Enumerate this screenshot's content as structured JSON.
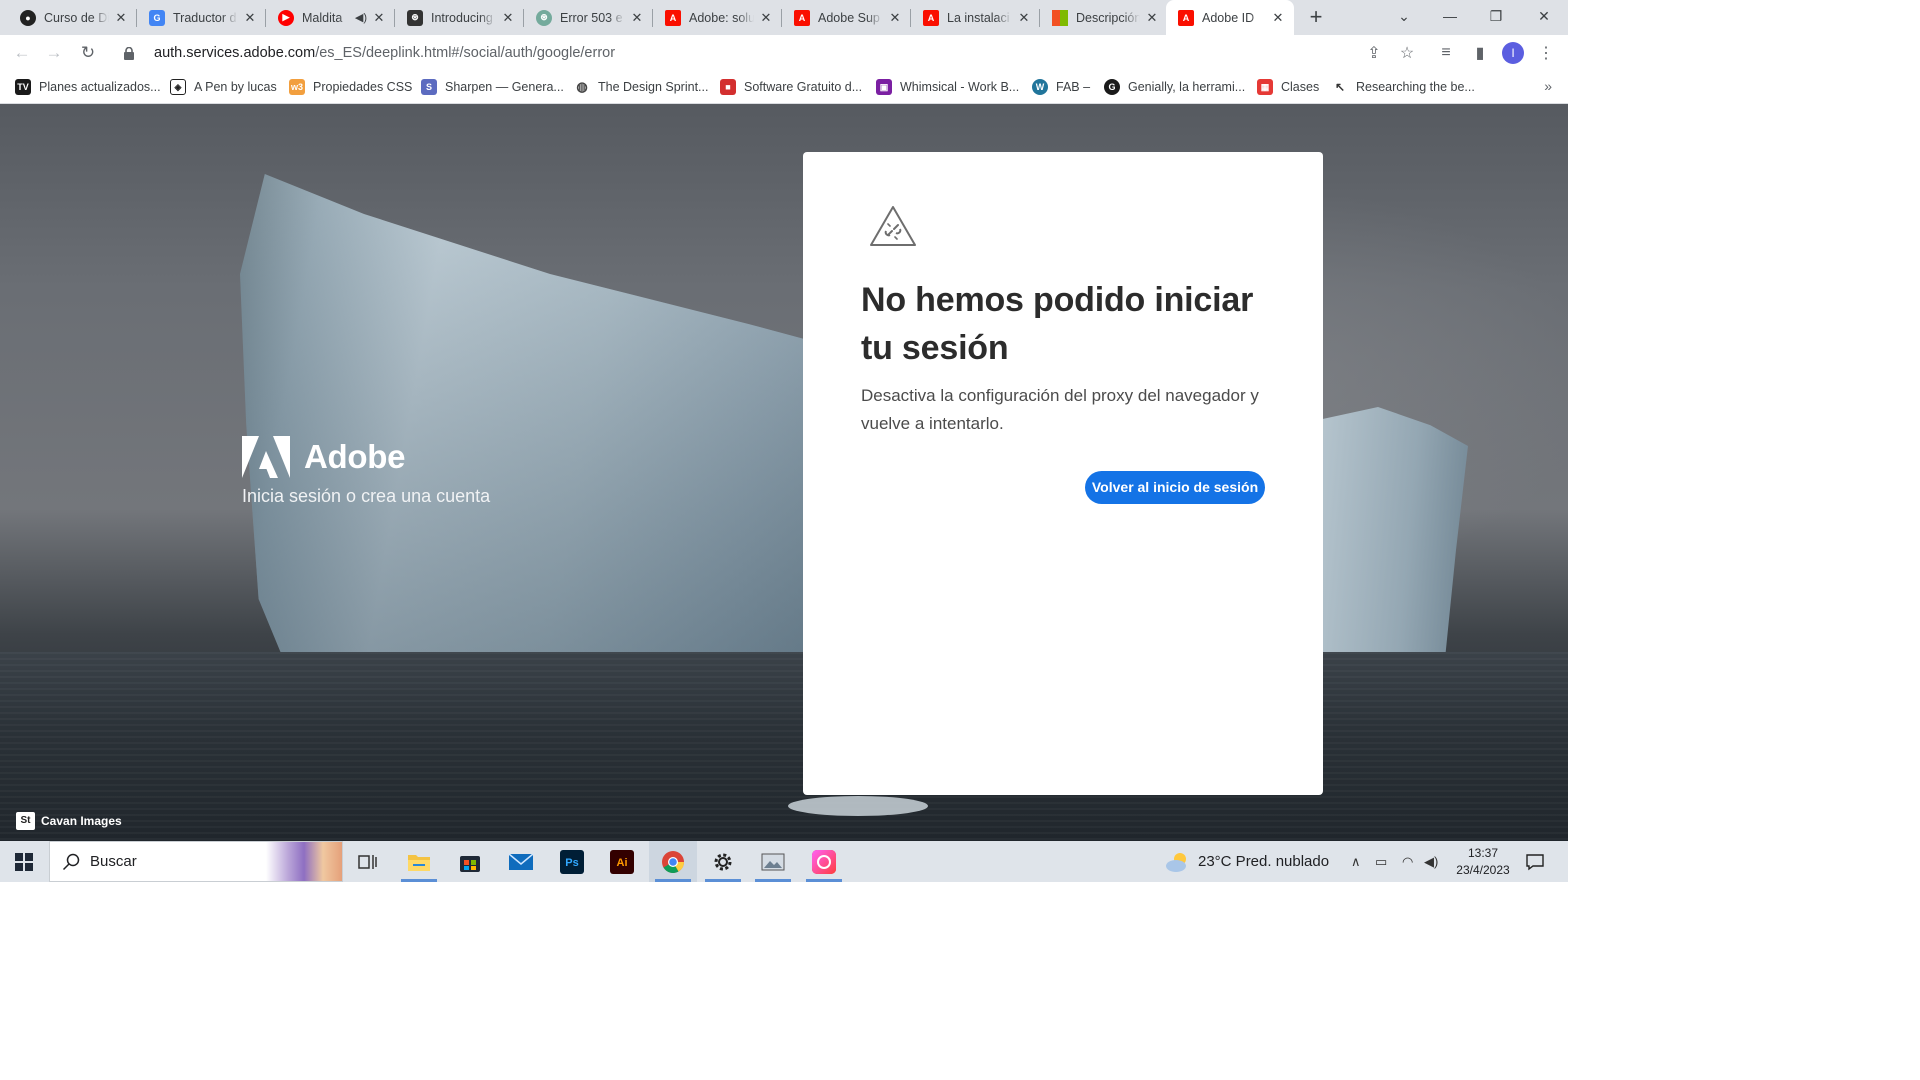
{
  "browser": {
    "tabs": [
      {
        "title": "Curso de Di",
        "favicon": "course-icon",
        "color": "#222222"
      },
      {
        "title": "Traductor d",
        "favicon": "google-translate-icon",
        "color": "#4285f4"
      },
      {
        "title": "Maldita",
        "favicon": "youtube-icon",
        "color": "#ff0000",
        "audio": "🔊"
      },
      {
        "title": "Introducing",
        "favicon": "openai-icon",
        "color": "#333333"
      },
      {
        "title": "Error 503 e",
        "favicon": "chatgpt-icon",
        "color": "#74aa9c"
      },
      {
        "title": "Adobe: solu",
        "favicon": "adobe-icon",
        "color": "#fa0f00"
      },
      {
        "title": "Adobe Sup",
        "favicon": "adobe-icon",
        "color": "#fa0f00"
      },
      {
        "title": "La instalaci",
        "favicon": "adobe-icon",
        "color": "#fa0f00"
      },
      {
        "title": "Descripción",
        "favicon": "microsoft-icon",
        "color": "#f25022"
      },
      {
        "title": "Adobe ID",
        "favicon": "adobe-icon",
        "color": "#fa0f00",
        "active": true
      }
    ],
    "url_host": "auth.services.adobe.com",
    "url_path": "/es_ES/deeplink.html#/social/auth/google/error",
    "profile_initial": "I",
    "bookmarks": [
      {
        "label": "Planes actualizados...",
        "icon": "tv-icon",
        "glyph": "TV",
        "color": "#1a1a1a"
      },
      {
        "label": "A Pen by lucas",
        "icon": "codepen-icon",
        "glyph": "◈",
        "color": "#ffffff"
      },
      {
        "label": "Propiedades CSS",
        "icon": "w3schools-icon",
        "glyph": "w3",
        "color": "#f29f3e"
      },
      {
        "label": "Sharpen — Genera...",
        "icon": "sharpen-icon",
        "glyph": "S",
        "color": "#5c6bc0"
      },
      {
        "label": "The Design Sprint...",
        "icon": "globe-icon",
        "glyph": "◍",
        "color": "#ffffff"
      },
      {
        "label": "Software Gratuito d...",
        "icon": "software-icon",
        "glyph": "■",
        "color": "#d32f2f"
      },
      {
        "label": "Whimsical - Work B...",
        "icon": "whimsical-icon",
        "glyph": "▣",
        "color": "#7b1fa2"
      },
      {
        "label": "FAB –",
        "icon": "wordpress-icon",
        "glyph": "W",
        "color": "#21759b"
      },
      {
        "label": "Genially, la herrami...",
        "icon": "genially-icon",
        "glyph": "G",
        "color": "#1a1a1a"
      },
      {
        "label": "Clases",
        "icon": "calendar-icon",
        "glyph": "▦",
        "color": "#e53935"
      },
      {
        "label": "Researching the be...",
        "icon": "research-icon",
        "glyph": "↖",
        "color": "#ffffff"
      }
    ]
  },
  "page": {
    "brand_name": "Adobe",
    "brand_tagline": "Inicia sesión o crea una cuenta",
    "error_title": "No hemos podido iniciar tu sesión",
    "error_message": "Desactiva la configuración del proxy del navegador y vuelve a intentarlo.",
    "cta_label": "Volver al inicio de sesión",
    "photo_credit": "Cavan Images",
    "credit_badge": "St",
    "accent_color": "#1473e6"
  },
  "taskbar": {
    "search_placeholder": "Buscar",
    "apps": [
      "task-view-icon",
      "file-explorer-icon",
      "microsoft-store-icon",
      "mail-icon",
      "photoshop-icon",
      "illustrator-icon",
      "chrome-icon",
      "settings-icon",
      "photo-viewer-icon",
      "creative-cloud-icon"
    ],
    "weather": "23°C  Pred. nublado",
    "time": "13:37",
    "date": "23/4/2023"
  }
}
